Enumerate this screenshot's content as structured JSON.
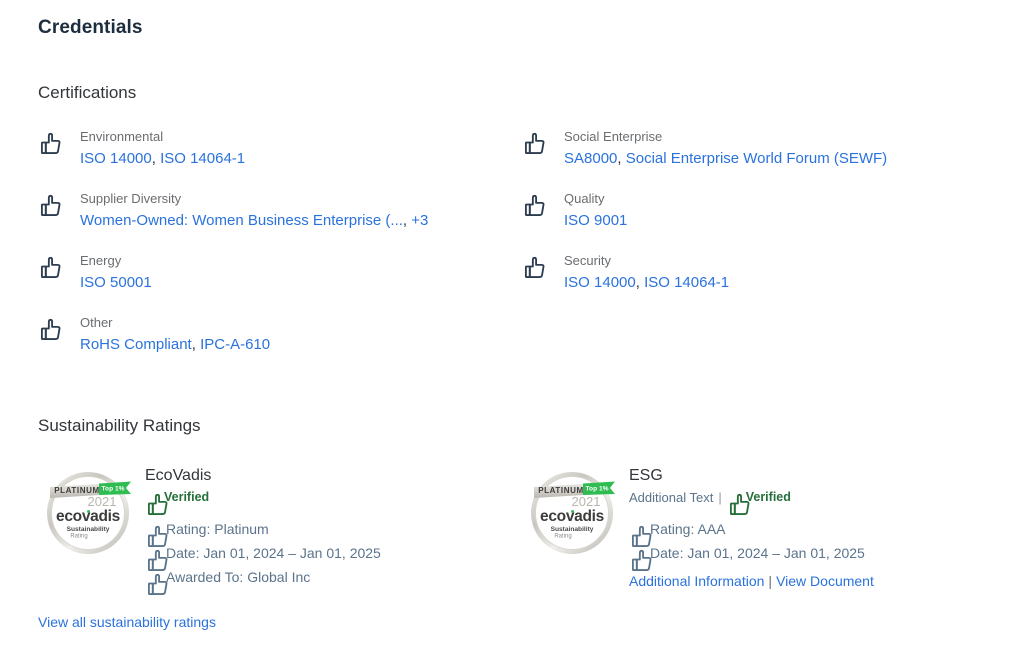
{
  "page": {
    "title": "Credentials"
  },
  "certifications": {
    "heading": "Certifications",
    "left": [
      {
        "icon": "thumbs-up-icon",
        "label": "Environmental",
        "values": [
          "ISO 14000",
          "ISO 14064-1"
        ],
        "more": ""
      },
      {
        "icon": "thumbs-up-icon",
        "label": "Supplier Diversity",
        "values": [
          "Women-Owned: Women Business Enterprise (..."
        ],
        "more": "+3"
      },
      {
        "icon": "thumbs-up-icon",
        "label": "Energy",
        "values": [
          "ISO 50001"
        ],
        "more": ""
      },
      {
        "icon": "thumbs-up-icon",
        "label": "Other",
        "values": [
          "RoHS Compliant",
          "IPC-A-610"
        ],
        "more": ""
      }
    ],
    "right": [
      {
        "icon": "thumbs-up-icon",
        "label": "Social Enterprise",
        "values": [
          "SA8000",
          "Social Enterprise World Forum (SEWF)"
        ],
        "more": ""
      },
      {
        "icon": "thumbs-up-icon",
        "label": "Quality",
        "values": [
          "ISO 9001"
        ],
        "more": ""
      },
      {
        "icon": "thumbs-up-icon",
        "label": "Security",
        "values": [
          "ISO 14000",
          "ISO 14064-1"
        ],
        "more": ""
      }
    ]
  },
  "sustainability": {
    "heading": "Sustainability Ratings",
    "badge": {
      "tier": "PLATINUM",
      "ribbon": "Top 1%",
      "year": "2021",
      "brand": "ecovadis",
      "sub_line1": "Sustainability",
      "sub_line2": "Rating"
    },
    "ratings": [
      {
        "name": "EcoVadis",
        "additional_text": "",
        "verified_label": "Verified",
        "attributes": [
          {
            "icon": "thumbs-up-icon",
            "text": "Rating: Platinum"
          },
          {
            "icon": "thumbs-up-icon",
            "text": "Date: Jan 01, 2024 – Jan 01, 2025"
          },
          {
            "icon": "thumbs-up-icon",
            "text": "Awarded To: Global Inc"
          }
        ],
        "links": []
      },
      {
        "name": "ESG",
        "additional_text": "Additional Text",
        "verified_label": "Verified",
        "attributes": [
          {
            "icon": "thumbs-up-icon",
            "text": "Rating: AAA"
          },
          {
            "icon": "thumbs-up-icon",
            "text": "Date: Jan 01, 2024 – Jan 01, 2025"
          }
        ],
        "links": [
          "Additional Information",
          "View Document"
        ]
      }
    ],
    "view_all_label": "View all sustainability ratings"
  },
  "colors": {
    "link_blue": "#2a72de",
    "heading_navy": "#1d2d3e",
    "label_gray": "#6a6d70",
    "verified_green": "#256f3a",
    "attr_slate": "#5b738b"
  }
}
